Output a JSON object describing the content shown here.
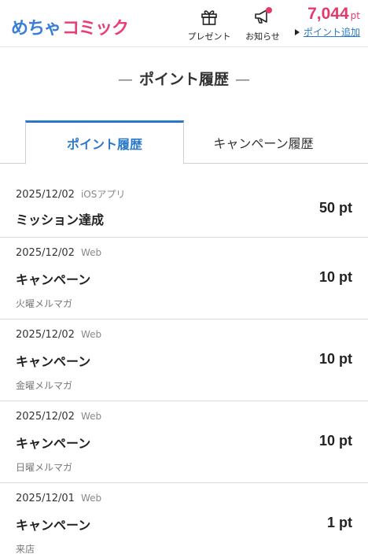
{
  "header": {
    "logo_part1": "めちゃ",
    "logo_part2": "コミック",
    "present_label": "プレゼント",
    "notice_label": "お知らせ",
    "points_value": "7,044",
    "points_unit": "pt",
    "add_points_label": "ポイント追加",
    "notice_badge_color": "#e6396b"
  },
  "title": "ポイント履歴",
  "title_dashes": [
    "—",
    "—"
  ],
  "tabs": [
    {
      "label": "ポイント履歴",
      "active": true
    },
    {
      "label": "キャンペーン履歴",
      "active": false
    }
  ],
  "history": [
    {
      "date": "2025/12/02",
      "source": "iOSアプリ",
      "title": "ミッション達成",
      "note": "",
      "amount": "50 pt"
    },
    {
      "date": "2025/12/02",
      "source": "Web",
      "title": "キャンペーン",
      "note": "火曜メルマガ",
      "amount": "10 pt"
    },
    {
      "date": "2025/12/02",
      "source": "Web",
      "title": "キャンペーン",
      "note": "金曜メルマガ",
      "amount": "10 pt"
    },
    {
      "date": "2025/12/02",
      "source": "Web",
      "title": "キャンペーン",
      "note": "日曜メルマガ",
      "amount": "10 pt"
    },
    {
      "date": "2025/12/01",
      "source": "Web",
      "title": "キャンペーン",
      "note": "来店",
      "amount": "1 pt"
    }
  ],
  "colors": {
    "accent": "#2a78c9",
    "points": "#e6396b",
    "logo_blue": "#3a7fd5",
    "logo_pink": "#e83f7a"
  }
}
